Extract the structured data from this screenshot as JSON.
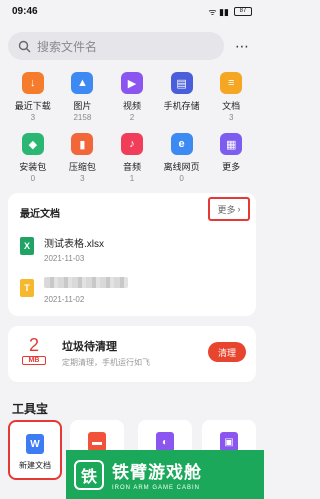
{
  "status_bar": {
    "time": "09:46",
    "battery": "87",
    "signal_text": "ᯤ ▮▮"
  },
  "search": {
    "placeholder": "搜索文件名",
    "more_icon": "⋯"
  },
  "categories": [
    {
      "label": "最近下载",
      "count": "3",
      "icon": "↓",
      "color": "#f57c2c"
    },
    {
      "label": "图片",
      "count": "2158",
      "icon": "▲",
      "color": "#3d8bf2"
    },
    {
      "label": "视频",
      "count": "2",
      "icon": "▶",
      "color": "#8b56f0"
    },
    {
      "label": "手机存储",
      "count": "",
      "icon": "▤",
      "color": "#4a5edb"
    },
    {
      "label": "文档",
      "count": "3",
      "icon": "≡",
      "color": "#f5a623"
    },
    {
      "label": "安装包",
      "count": "0",
      "icon": "◆",
      "color": "#2bb673"
    },
    {
      "label": "压缩包",
      "count": "3",
      "icon": "▮",
      "color": "#f1673a"
    },
    {
      "label": "音频",
      "count": "1",
      "icon": "♪",
      "color": "#f03e5a"
    },
    {
      "label": "离线网页",
      "count": "0",
      "icon": "e",
      "color": "#3d8bf2"
    },
    {
      "label": "更多",
      "count": "",
      "icon": "▦",
      "color": "#7d5cf0"
    }
  ],
  "recent": {
    "title": "最近文档",
    "more_label": "更多",
    "files": [
      {
        "name": "测试表格.xlsx",
        "date": "2021-11-03",
        "icon": "X",
        "color": "#21a366"
      },
      {
        "name": "",
        "date": "2021-11-02",
        "icon": "T",
        "color": "#f5b82e"
      }
    ]
  },
  "trash": {
    "size_value": "2",
    "size_unit": "MB",
    "title": "垃圾待清理",
    "subtitle": "定期清理，手机运行如飞",
    "button": "清理"
  },
  "tools": {
    "title": "工具宝",
    "items": [
      {
        "label": "新建文档",
        "icon": "W",
        "color": "#3d7cf2"
      },
      {
        "label": "",
        "icon": "▬",
        "color": "#f0533a"
      },
      {
        "label": "",
        "icon": "◐",
        "color": "#8b56f0"
      },
      {
        "label": "",
        "icon": "▣",
        "color": "#8b56f0"
      }
    ]
  },
  "watermark": {
    "logo": "铁",
    "title": "铁臂游戏舱",
    "subtitle": "IRON ARM GAME CABIN"
  }
}
